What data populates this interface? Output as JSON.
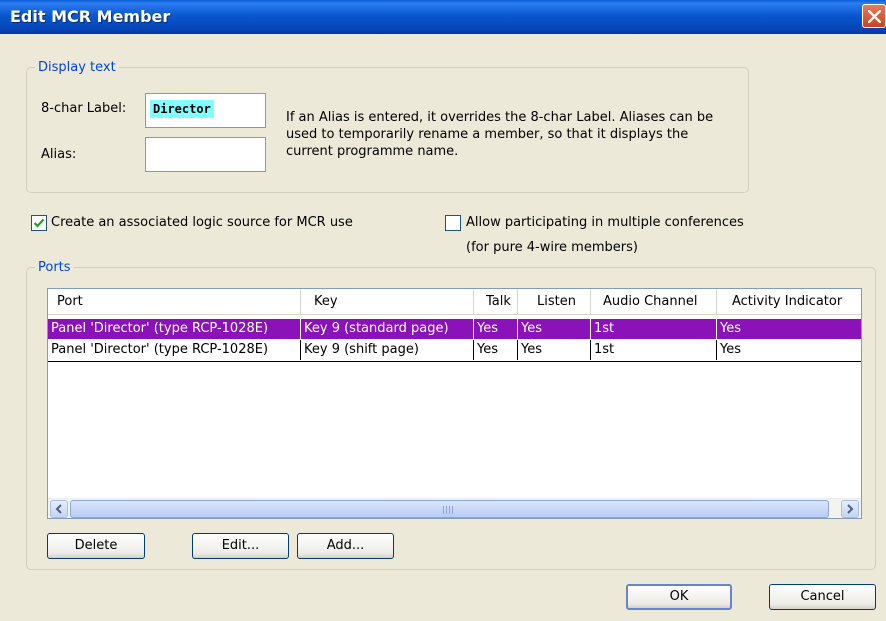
{
  "window": {
    "title": "Edit MCR Member"
  },
  "display_text": {
    "group_label": "Display text",
    "label_caption": "8-char Label:",
    "label_value": "Director",
    "alias_caption": "Alias:",
    "alias_value": "",
    "help_text": "If an Alias is entered, it overrides the 8-char Label. Aliases can be used to temporarily rename a member, so that it displays the current programme name."
  },
  "options": {
    "create_logic_source": {
      "label": "Create an associated logic source for MCR use",
      "checked": true
    },
    "multiple_conferences": {
      "label": "Allow participating in multiple conferences",
      "note": "(for pure 4-wire members)",
      "checked": false
    }
  },
  "ports": {
    "group_label": "Ports",
    "columns": [
      "Port",
      "Key",
      "Talk",
      "Listen",
      "Audio Channel",
      "Activity Indicator"
    ],
    "rows": [
      [
        "Panel 'Director' (type RCP-1028E)",
        "Key 9 (standard page)",
        "Yes",
        "Yes",
        "1st",
        "Yes"
      ],
      [
        "Panel 'Director' (type RCP-1028E)",
        "Key 9 (shift page)",
        "Yes",
        "Yes",
        "1st",
        "Yes"
      ]
    ],
    "selected_row": 0,
    "buttons": {
      "delete": "Delete",
      "edit": "Edit...",
      "add": "Add..."
    }
  },
  "footer": {
    "ok": "OK",
    "cancel": "Cancel"
  },
  "colors": {
    "selection": "#8b12b8",
    "label_highlight": "#80ffff",
    "group_label": "#0046d5"
  }
}
